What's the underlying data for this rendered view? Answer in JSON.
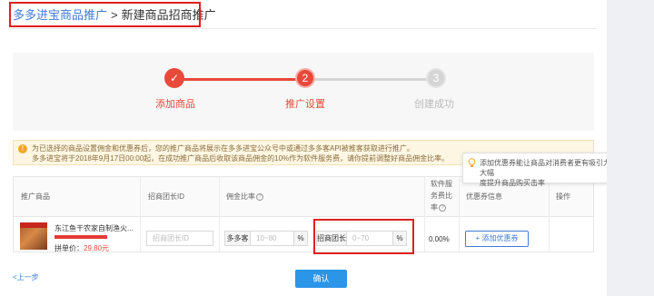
{
  "breadcrumb": {
    "parent": "多多进宝商品推广",
    "separator": ">",
    "current": "新建商品招商推广"
  },
  "steps": [
    {
      "number": "✓",
      "label": "添加商品",
      "state": "done"
    },
    {
      "number": "2",
      "label": "推广设置",
      "state": "active"
    },
    {
      "number": "3",
      "label": "创建成功",
      "state": "todo"
    }
  ],
  "notice": {
    "line1": "为已选择的商品设置佣金和优惠券后，您的推广商品将展示在多多进宝公众号中或通过多多客API被推客获取进行推广。",
    "line2": "多多进宝将于2018年9月17日00:00起，在成功推广商品后收取该商品佣金的10%作为软件服务费，请你提前调整好商品佣金比率。"
  },
  "tooltip": {
    "line1": "添加优惠券能让商品对消费者更有吸引力，能大幅",
    "line2": "度提升商品购买击率",
    "close": "×"
  },
  "table": {
    "headers": {
      "product": "推广商品",
      "leader_id": "招商团长ID",
      "commission": "佣金比率",
      "fee_1": "软件服",
      "fee_2": "务费比",
      "fee_3": "率",
      "coupon": "优惠券信息",
      "action": "操作"
    },
    "row": {
      "product_name": "东江鱼干农家自制渔火...",
      "price_label": "拼单价：",
      "price": "29.80元",
      "leader_placeholder": "招商团长ID",
      "duoduo_label": "多多客",
      "duoduo_placeholder": "10~80",
      "duoduo_unit": "%",
      "leader_label": "招商团长",
      "leader_rate_placeholder": "0~70",
      "leader_unit": "%",
      "service_fee": "0.00%",
      "add_coupon": "+ 添加优惠券"
    }
  },
  "footer": {
    "prev": "<上一步",
    "confirm": "确认"
  },
  "colors": {
    "accent_red": "#e8493a",
    "link_blue": "#3f7bd6",
    "button_blue": "#2b95e8",
    "highlight_red": "#e02020"
  }
}
